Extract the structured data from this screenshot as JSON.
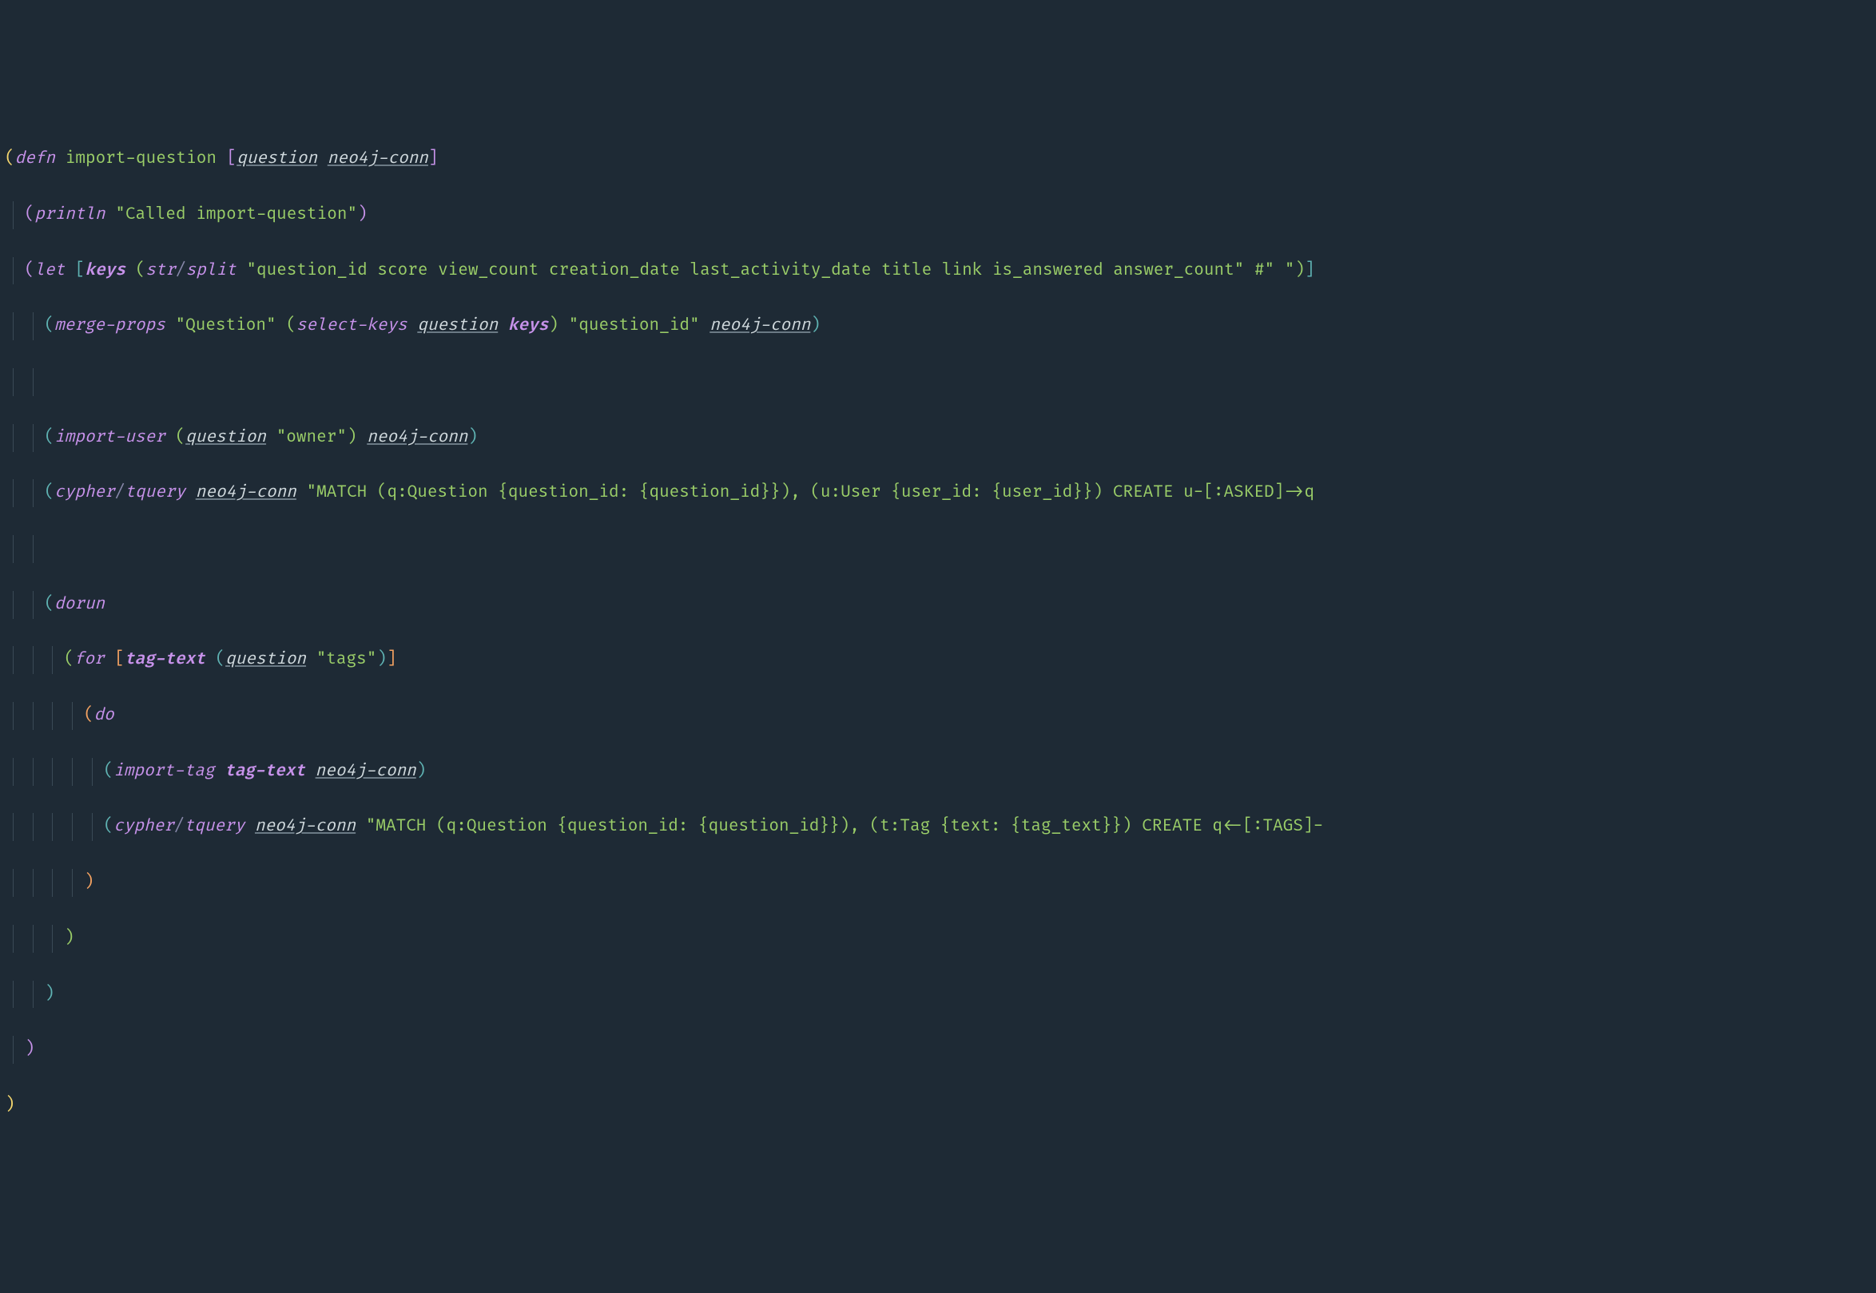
{
  "line1": {
    "defn": "defn",
    "fnname": "import-question",
    "arg1": "question",
    "arg2": "neo4j-conn"
  },
  "line2": {
    "println": "println",
    "str": "\"Called import-question\""
  },
  "line3": {
    "let": "let",
    "keys_sym": "keys",
    "str_ns": "str",
    "slash": "/",
    "split": "split",
    "fields": "\"question_id score view_count creation_date last_activity_date title link is_answered answer_count\"",
    "regex": "#\" \""
  },
  "line4": {
    "merge_props": "merge-props",
    "question_lbl": "\"Question\"",
    "select_keys": "select-keys",
    "question_arg": "question",
    "keys_sym": "keys",
    "question_id": "\"question_id\"",
    "neo4j": "neo4j-conn"
  },
  "line6": {
    "import_user": "import-user",
    "question_arg": "question",
    "owner": "\"owner\"",
    "neo4j": "neo4j-conn"
  },
  "line7": {
    "cypher": "cypher",
    "slash": "/",
    "tquery": "tquery",
    "neo4j": "neo4j-conn",
    "query": "\"MATCH (q:Question {question_id: {question_id}}), (u:User {user_id: {user_id}}) CREATE u-[:ASKED]->q"
  },
  "line9": {
    "dorun": "dorun"
  },
  "line10": {
    "for": "for",
    "tag_text": "tag-text",
    "question_arg": "question",
    "tags": "\"tags\""
  },
  "line11": {
    "do": "do"
  },
  "line12": {
    "import_tag": "import-tag",
    "tag_text": "tag-text",
    "neo4j": "neo4j-conn"
  },
  "line13": {
    "cypher": "cypher",
    "slash": "/",
    "tquery": "tquery",
    "neo4j": "neo4j-conn",
    "query": "\"MATCH (q:Question {question_id: {question_id}}), (t:Tag {text: {tag_text}}) CREATE q<-[:TAGS]-"
  }
}
